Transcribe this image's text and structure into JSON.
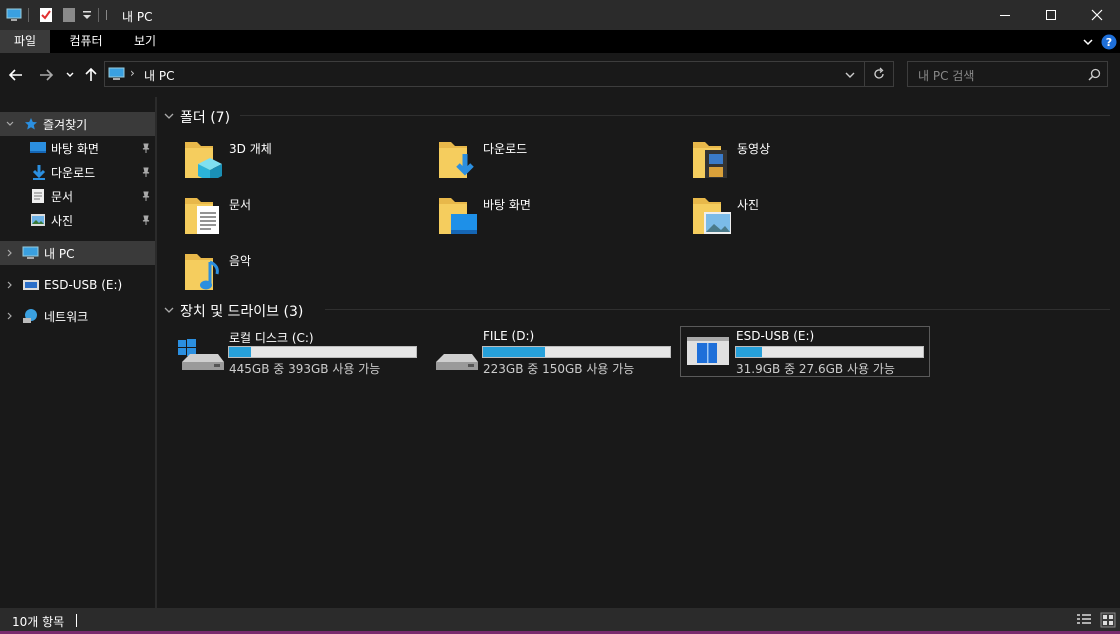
{
  "window": {
    "title": "내 PC"
  },
  "ribbon": {
    "tabs": [
      "파일",
      "컴퓨터",
      "보기"
    ]
  },
  "address": {
    "path": "내 PC",
    "search_placeholder": "내 PC 검색"
  },
  "nav": {
    "quick_access": "즐겨찾기",
    "pinned": [
      "바탕 화면",
      "다운로드",
      "문서",
      "사진"
    ],
    "this_pc": "내 PC",
    "usb": "ESD-USB (E:)",
    "network": "네트워크"
  },
  "content": {
    "folders_header": "폴더 (7)",
    "folders": [
      "3D 개체",
      "다운로드",
      "동영상",
      "문서",
      "바탕 화면",
      "사진",
      "음악"
    ],
    "drives_header": "장치 및 드라이브 (3)",
    "drives": [
      {
        "name": "로컬 디스크 (C:)",
        "info": "445GB 중 393GB 사용 가능",
        "used_fraction": 0.12
      },
      {
        "name": "FILE (D:)",
        "info": "223GB 중 150GB 사용 가능",
        "used_fraction": 0.33
      },
      {
        "name": "ESD-USB (E:)",
        "info": "31.9GB 중 27.6GB 사용 가능",
        "used_fraction": 0.14
      }
    ]
  },
  "status": {
    "count": "10개 항목"
  }
}
